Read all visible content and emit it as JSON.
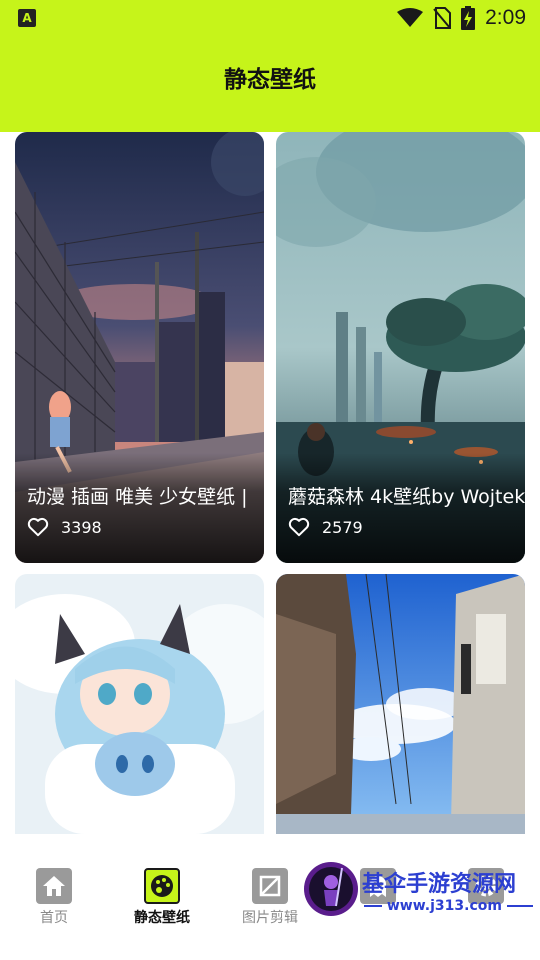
{
  "theme": {
    "accent": "#c6f41a",
    "text": "#111111",
    "nav_inactive": "#8a8a8a"
  },
  "status_bar": {
    "left_icon": "A",
    "time": "2:09",
    "icons": [
      "wifi-icon",
      "no-sim-icon",
      "battery-charging-icon"
    ]
  },
  "header": {
    "title": "静态壁纸"
  },
  "wallpapers": [
    {
      "caption": "动漫 插画 唯美 少女壁纸 |",
      "likes": "3398",
      "like_icon": "heart-outline-icon"
    },
    {
      "caption": "蘑菇森林 4k壁纸by Wojtek",
      "likes": "2579",
      "like_icon": "heart-outline-icon"
    },
    {
      "caption": "",
      "likes": ""
    },
    {
      "caption": "",
      "likes": ""
    }
  ],
  "bottom_nav": [
    {
      "label": "首页",
      "icon": "home-icon",
      "active": false
    },
    {
      "label": "静态壁纸",
      "icon": "palette-icon",
      "active": true
    },
    {
      "label": "图片剪辑",
      "icon": "image-crop-icon",
      "active": false
    },
    {
      "label": "",
      "icon": "ghost-icon",
      "active": false
    },
    {
      "label": "",
      "icon": "gear-icon",
      "active": false
    }
  ],
  "watermark": {
    "name": "基伞手游资源网",
    "url": "www.j313.com",
    "icon": "swordsman-logo-icon"
  }
}
